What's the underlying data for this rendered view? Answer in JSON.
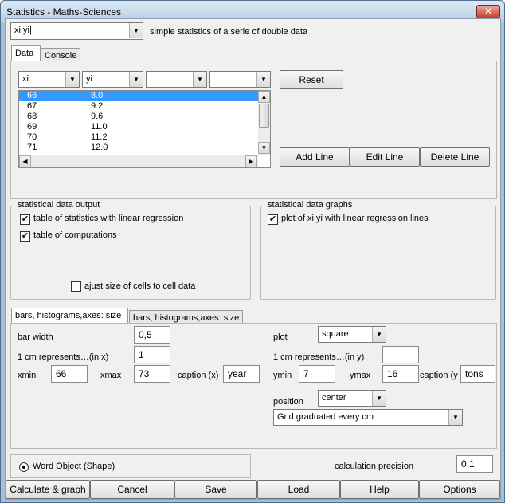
{
  "window": {
    "title": "Statistics - Maths-Sciences",
    "close": "✕"
  },
  "top": {
    "mode_value": "xi;yi|",
    "description": "simple statistics of a serie of double data"
  },
  "tabs": {
    "data": "Data",
    "console": "Console"
  },
  "grid": {
    "col1": "xi",
    "col2": "yi",
    "col3": "",
    "col4": "",
    "rows": [
      {
        "x": "66",
        "y": "8.0"
      },
      {
        "x": "67",
        "y": "9.2"
      },
      {
        "x": "68",
        "y": "9.6"
      },
      {
        "x": "69",
        "y": "11.0"
      },
      {
        "x": "70",
        "y": "11.2"
      },
      {
        "x": "71",
        "y": "12.0"
      }
    ],
    "selected_index": 0
  },
  "buttons": {
    "reset": "Reset",
    "add_line": "Add Line",
    "edit_line": "Edit Line",
    "delete_line": "Delete Line"
  },
  "output": {
    "title": "statistical data output",
    "stats_lr": "table of statistics with linear regression",
    "computations": "table of computations",
    "adjust": "ajust size of cells to cell data",
    "stats_lr_checked": true,
    "computations_checked": true,
    "adjust_checked": false
  },
  "graphs": {
    "title": "statistical data graphs",
    "plot": "plot of xi;yi with linear regression lines",
    "plot_checked": true
  },
  "bars_tabs": {
    "tab1": "bars, histograms,axes: size",
    "tab2": "bars, histograms,axes: size"
  },
  "params": {
    "bar_width_label": "bar width",
    "bar_width": "0,5",
    "cm_x_label": "1 cm represents…(in x)",
    "cm_x": "1",
    "xmin_label": "xmin",
    "xmin": "66",
    "xmax_label": "xmax",
    "xmax": "73",
    "caption_x_label": "caption (x)",
    "caption_x": "year",
    "plot_label": "plot",
    "plot_value": "square",
    "cm_y_label": "1 cm represents…(in y)",
    "cm_y": "",
    "ymin_label": "ymin",
    "ymin": "7",
    "ymax_label": "ymax",
    "ymax": "16",
    "caption_y_label": "caption (y",
    "caption_y": "tons",
    "position_label": "position",
    "position_value": "center",
    "grid_value": "Grid graduated every cm"
  },
  "bottom": {
    "word_object": "Word Object (Shape)",
    "precision_label": "calculation precision",
    "precision": "0.1"
  },
  "footer": {
    "calc": "Calculate & graph",
    "cancel": "Cancel",
    "save": "Save",
    "load": "Load",
    "help": "Help",
    "options": "Options"
  }
}
